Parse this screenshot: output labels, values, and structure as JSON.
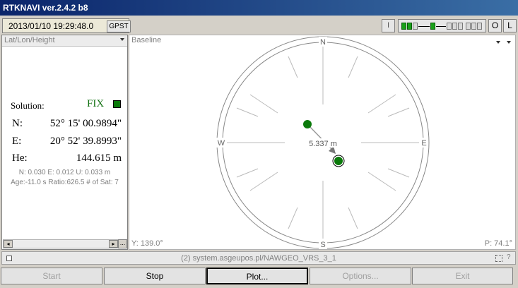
{
  "window": {
    "title": "RTKNAVI ver.2.4.2 b8"
  },
  "toolbar": {
    "datetime": "2013/01/10 19:29:48.0",
    "time_system": "GPST",
    "btn_i": "I",
    "btn_o": "O",
    "btn_l": "L"
  },
  "left_panel": {
    "mode": "Lat/Lon/Height",
    "solution_label": "Solution:",
    "solution_value": "FIX",
    "solution_color": "#107010",
    "lat_label": "N:",
    "lat_value": "52° 15' 00.9894\"",
    "lon_label": "E:",
    "lon_value": "20° 52' 39.8993\"",
    "height_label": "He:",
    "height_value": "144.615 m",
    "std_line": "N: 0.030 E: 0.012 U: 0.033 m",
    "age_line": "Age:-11.0 s Ratio:626.5 # of Sat: 7",
    "ellipsis": "..."
  },
  "right_panel": {
    "mode": "Baseline",
    "compass": {
      "n": "N",
      "e": "E",
      "s": "S",
      "w": "W"
    },
    "baseline_length": "5.337 m",
    "yaw": "Y: 139.0°",
    "pitch": "P: 74.1°"
  },
  "status_bar": {
    "stream": "(2) system.asgeupos.pl/NAWGEO_VRS_3_1",
    "help": "?"
  },
  "buttons": {
    "start": "Start",
    "stop": "Stop",
    "plot": "Plot...",
    "options": "Options...",
    "exit": "Exit"
  }
}
